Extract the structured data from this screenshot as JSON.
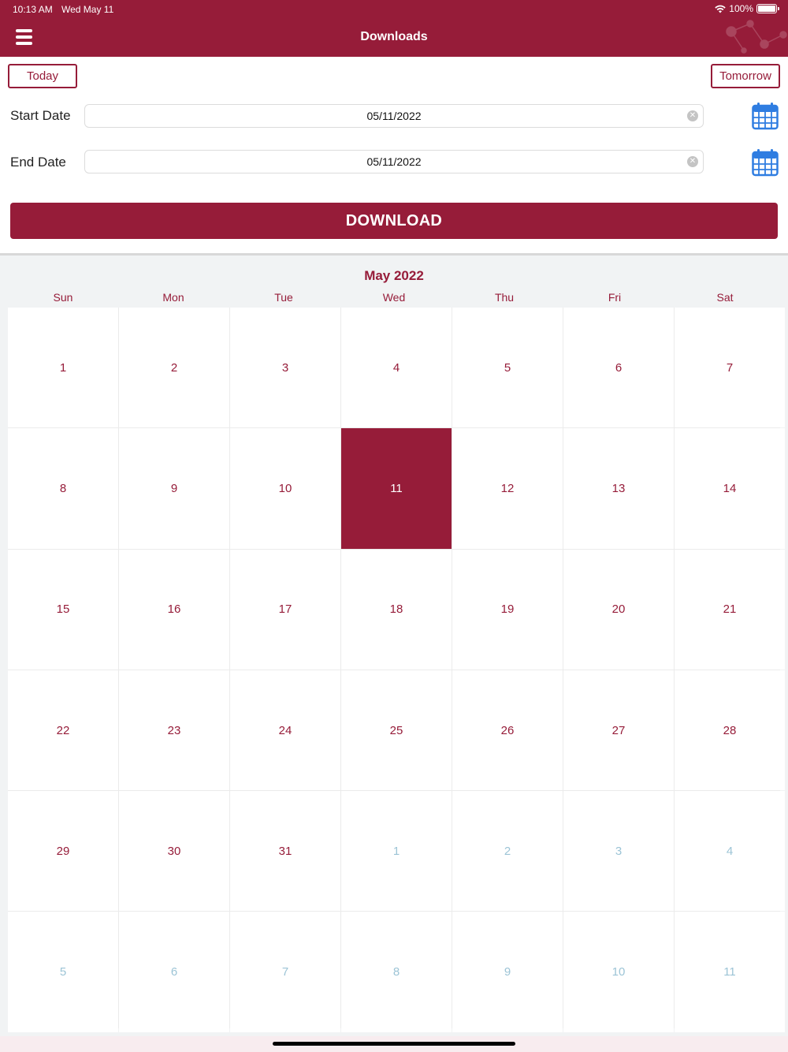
{
  "status_bar": {
    "time": "10:13 AM",
    "date": "Wed May 11",
    "battery": "100%"
  },
  "header": {
    "title": "Downloads",
    "menu_icon": "hamburger-menu-icon",
    "color": "#961c39"
  },
  "quick_buttons": {
    "today": "Today",
    "tomorrow": "Tomorrow"
  },
  "start_date": {
    "label": "Start Date",
    "value": "05/11/2022"
  },
  "end_date": {
    "label": "End Date",
    "value": "05/11/2022"
  },
  "download_label": "DOWNLOAD",
  "calendar": {
    "month_title": "May 2022",
    "weekdays": [
      "Sun",
      "Mon",
      "Tue",
      "Wed",
      "Thu",
      "Fri",
      "Sat"
    ],
    "selected_day": "11",
    "days": [
      "1",
      "2",
      "3",
      "4",
      "5",
      "6",
      "7",
      "8",
      "9",
      "10",
      "11",
      "12",
      "13",
      "14",
      "15",
      "16",
      "17",
      "18",
      "19",
      "20",
      "21",
      "22",
      "23",
      "24",
      "25",
      "26",
      "27",
      "28",
      "29",
      "30",
      "31",
      "1",
      "2",
      "3",
      "4",
      "5",
      "6",
      "7",
      "8",
      "9",
      "10",
      "11"
    ],
    "in_month": [
      true,
      true,
      true,
      true,
      true,
      true,
      true,
      true,
      true,
      true,
      true,
      true,
      true,
      true,
      true,
      true,
      true,
      true,
      true,
      true,
      true,
      true,
      true,
      true,
      true,
      true,
      true,
      true,
      true,
      true,
      true,
      false,
      false,
      false,
      false,
      false,
      false,
      false,
      false,
      false,
      false,
      false
    ],
    "accent_color": "#961c39",
    "other_month_color": "#9cc4d6"
  }
}
